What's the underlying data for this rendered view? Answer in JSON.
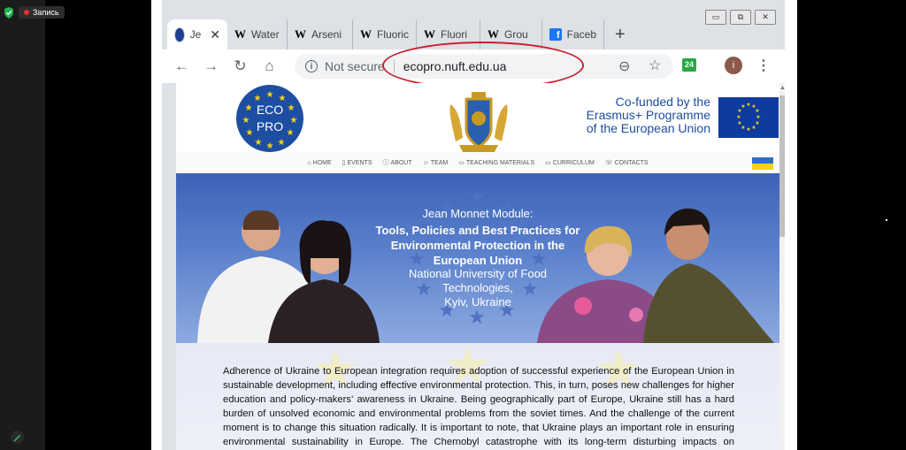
{
  "zoom": {
    "record_label": "Запись"
  },
  "browser": {
    "tabs": [
      {
        "label": "Je",
        "icon": "eu-circle-icon",
        "active": true
      },
      {
        "label": "Water",
        "icon": "wikipedia-icon"
      },
      {
        "label": "Arseni",
        "icon": "wikipedia-icon"
      },
      {
        "label": "Fluoric",
        "icon": "wikipedia-icon"
      },
      {
        "label": "Fluori",
        "icon": "wikipedia-icon"
      },
      {
        "label": "Grou",
        "icon": "wikipedia-icon"
      },
      {
        "label": "Faceb",
        "icon": "facebook-icon"
      }
    ],
    "security_label": "Not secure",
    "url": "ecopro.nuft.edu.ua",
    "extension_badge": "24",
    "avatar_letter": "i"
  },
  "site": {
    "eco_logo_line1": "ECO",
    "eco_logo_line2": "PRO",
    "cofunded_lines": [
      "Co-funded by the",
      "Erasmus+ Programme",
      "of the European Union"
    ],
    "nav": [
      "HOME",
      "EVENTS",
      "ABOUT",
      "TEAM",
      "TEACHING MATERIALS",
      "CURRICULUM",
      "CONTACTS"
    ],
    "hero_sub": "Jean Monnet Module:",
    "hero_title_lines": [
      "Tools, Policies and Best Practices for",
      "Environmental Protection in the",
      "European Union"
    ],
    "hero_body_lines": [
      "National University of Food",
      "Technologies,",
      "Kyiv, Ukraine"
    ],
    "intro_paragraph": "Adherence of Ukraine to European integration requires adoption of successful experience of the European Union in sustainable development, including effective environmental protection. This, in turn, poses new challenges for higher education and policy-makers’ awareness in Ukraine. Being geographically part of Europe, Ukraine still has a hard burden of unsolved economic and environmental problems from the soviet times. And the challenge of the current moment is to change this situation radically. It is important to note, that Ukraine plays an important role in ensuring environmental sustainability in Europe. The Chernobyl catastrophe with its long-term disturbing impacts on ecosystems and public health"
  }
}
